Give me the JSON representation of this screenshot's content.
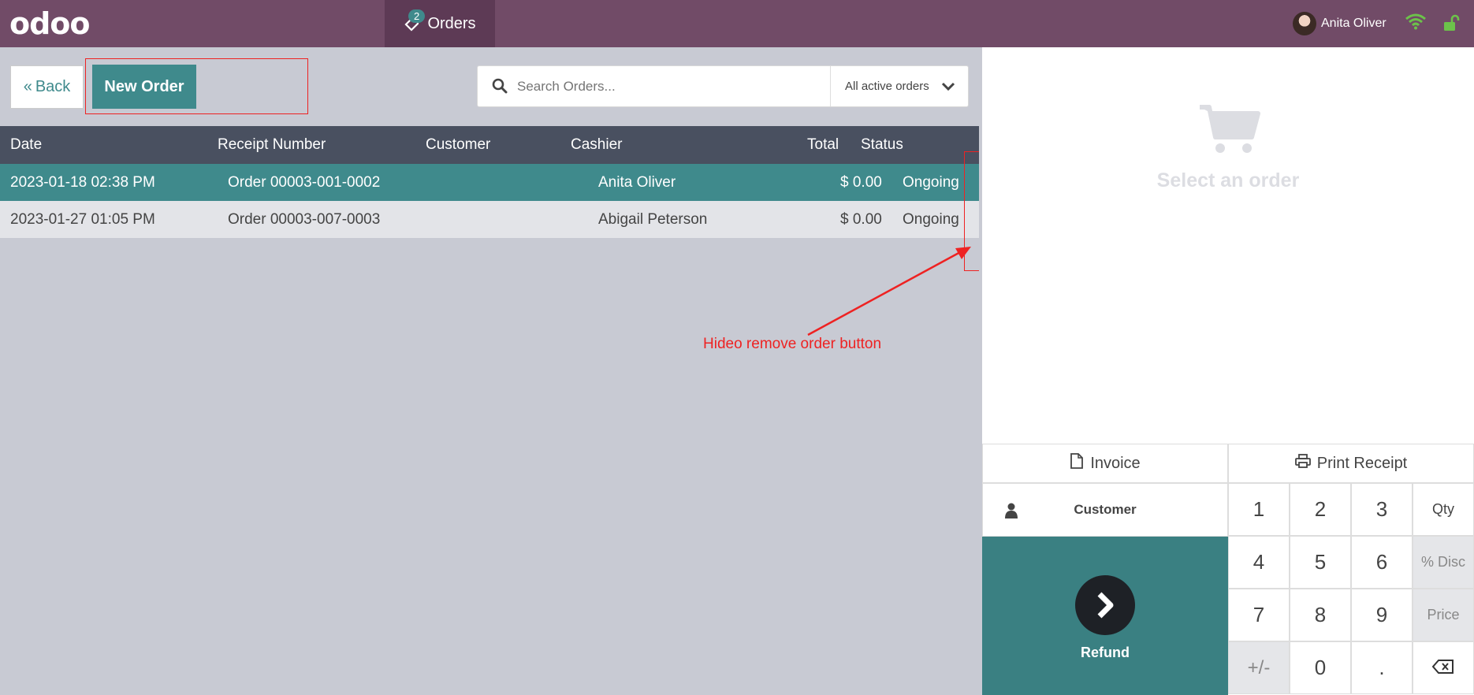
{
  "topbar": {
    "logo": "odoo",
    "orders_tab_label": "Orders",
    "orders_badge": "2",
    "user_name": "Anita Oliver"
  },
  "controls": {
    "back_label": "Back",
    "new_order_label": "New Order",
    "search_placeholder": "Search Orders...",
    "filter_label": "All active orders"
  },
  "table": {
    "headers": [
      "Date",
      "Receipt Number",
      "Customer",
      "Cashier",
      "Total",
      "Status"
    ],
    "rows": [
      {
        "date": "2023-01-18 02:38 PM",
        "receipt": "Order 00003-001-0002",
        "customer": "",
        "cashier": "Anita Oliver",
        "total": "$ 0.00",
        "status": "Ongoing"
      },
      {
        "date": "2023-01-27 01:05 PM",
        "receipt": "Order 00003-007-0003",
        "customer": "",
        "cashier": "Abigail Peterson",
        "total": "$ 0.00",
        "status": "Ongoing"
      }
    ]
  },
  "annotation": "Hideo remove order button",
  "right_pane": {
    "empty_text": "Select an order",
    "invoice_label": "Invoice",
    "print_label": "Print Receipt",
    "customer_label": "Customer",
    "refund_label": "Refund",
    "numpad": [
      "1",
      "2",
      "3",
      "Qty",
      "4",
      "5",
      "6",
      "% Disc",
      "7",
      "8",
      "9",
      "Price",
      "+/-",
      "0",
      ".",
      "backspace"
    ]
  },
  "colors": {
    "topbar": "#714b67",
    "accent": "#3f8a8c",
    "annotation": "#ee2222"
  }
}
